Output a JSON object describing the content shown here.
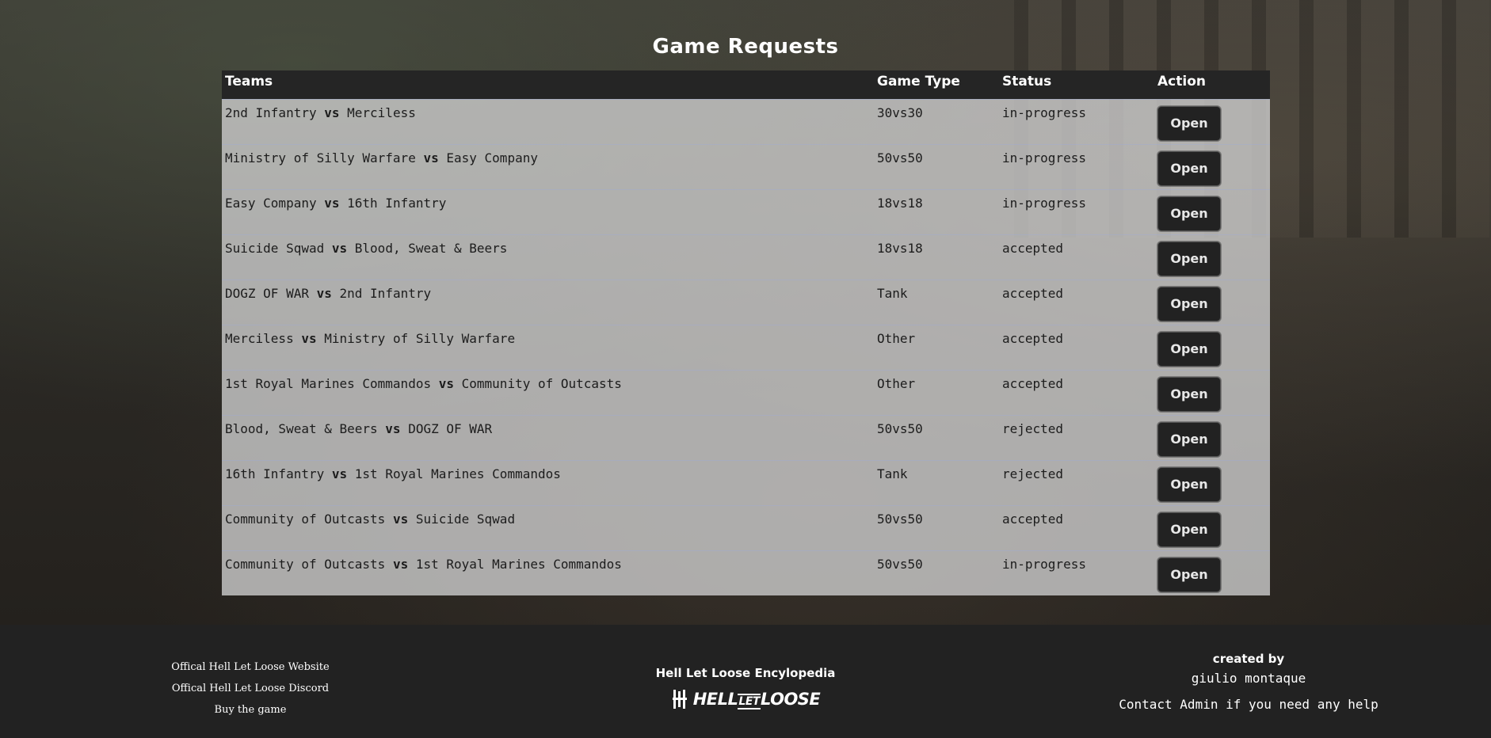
{
  "page": {
    "title": "Game Requests"
  },
  "table": {
    "headers": {
      "teams": "Teams",
      "game_type": "Game Type",
      "status": "Status",
      "action": "Action"
    },
    "vs_label": "vs",
    "open_label": "Open",
    "rows": [
      {
        "team_a": "2nd Infantry",
        "team_b": "Merciless",
        "game_type": "30vs30",
        "status": "in-progress"
      },
      {
        "team_a": "Ministry of Silly Warfare",
        "team_b": "Easy Company",
        "game_type": "50vs50",
        "status": "in-progress"
      },
      {
        "team_a": "Easy Company",
        "team_b": "16th Infantry",
        "game_type": "18vs18",
        "status": "in-progress"
      },
      {
        "team_a": "Suicide Sqwad",
        "team_b": "Blood, Sweat & Beers",
        "game_type": "18vs18",
        "status": "accepted"
      },
      {
        "team_a": "DOGZ OF WAR",
        "team_b": "2nd Infantry",
        "game_type": "Tank",
        "status": "accepted"
      },
      {
        "team_a": "Merciless",
        "team_b": "Ministry of Silly Warfare",
        "game_type": "Other",
        "status": "accepted"
      },
      {
        "team_a": "1st Royal Marines Commandos",
        "team_b": "Community of Outcasts",
        "game_type": "Other",
        "status": "accepted"
      },
      {
        "team_a": "Blood, Sweat & Beers",
        "team_b": "DOGZ OF WAR",
        "game_type": "50vs50",
        "status": "rejected"
      },
      {
        "team_a": "16th Infantry",
        "team_b": "1st Royal Marines Commandos",
        "game_type": "Tank",
        "status": "rejected"
      },
      {
        "team_a": "Community of Outcasts",
        "team_b": "Suicide Sqwad",
        "game_type": "50vs50",
        "status": "accepted"
      },
      {
        "team_a": "Community of Outcasts",
        "team_b": "1st Royal Marines Commandos",
        "game_type": "50vs50",
        "status": "in-progress"
      }
    ]
  },
  "footer": {
    "links": [
      "Offical Hell Let Loose Website",
      "Offical Hell Let Loose Discord",
      "Buy the game"
    ],
    "center_title": "Hell Let Loose Encylopedia",
    "logo": {
      "part1": "HELL",
      "part2": "LET",
      "part3": "LOOSE"
    },
    "created_by_label": "created by",
    "author": "giulio montaque",
    "contact": "Contact Admin if you need any help"
  },
  "colors": {
    "header_bg": "#252525",
    "row_bg": "#cdcdcd",
    "button_bg": "#222222",
    "footer_bg": "#222222"
  }
}
